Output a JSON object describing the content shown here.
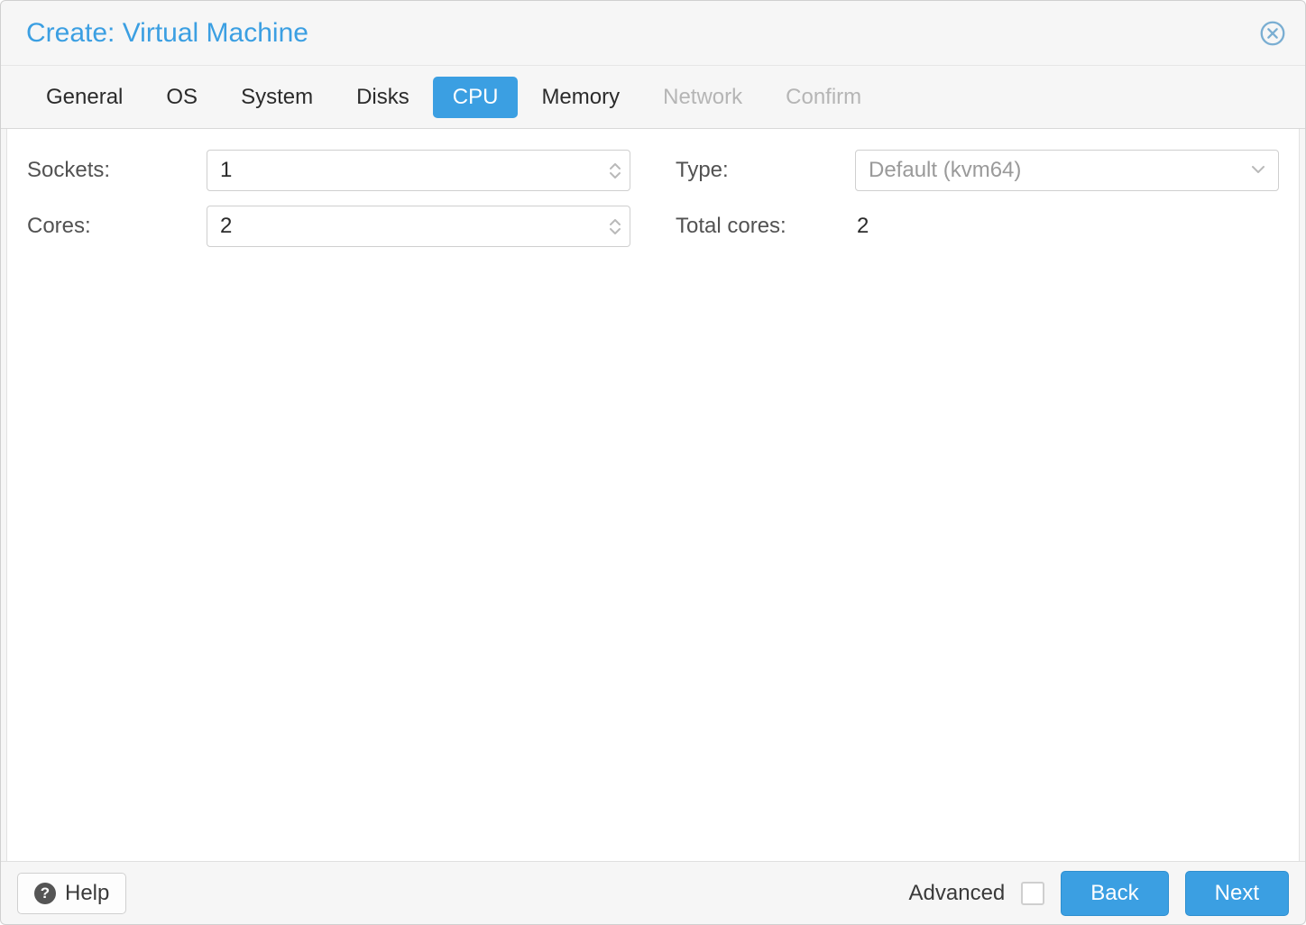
{
  "window": {
    "title": "Create: Virtual Machine"
  },
  "tabs": [
    {
      "label": "General",
      "state": "normal"
    },
    {
      "label": "OS",
      "state": "normal"
    },
    {
      "label": "System",
      "state": "normal"
    },
    {
      "label": "Disks",
      "state": "normal"
    },
    {
      "label": "CPU",
      "state": "active"
    },
    {
      "label": "Memory",
      "state": "normal"
    },
    {
      "label": "Network",
      "state": "disabled"
    },
    {
      "label": "Confirm",
      "state": "disabled"
    }
  ],
  "form": {
    "sockets_label": "Sockets:",
    "sockets_value": "1",
    "cores_label": "Cores:",
    "cores_value": "2",
    "type_label": "Type:",
    "type_value": "Default (kvm64)",
    "total_cores_label": "Total cores:",
    "total_cores_value": "2"
  },
  "footer": {
    "help_label": "Help",
    "advanced_label": "Advanced",
    "advanced_checked": false,
    "back_label": "Back",
    "next_label": "Next"
  }
}
